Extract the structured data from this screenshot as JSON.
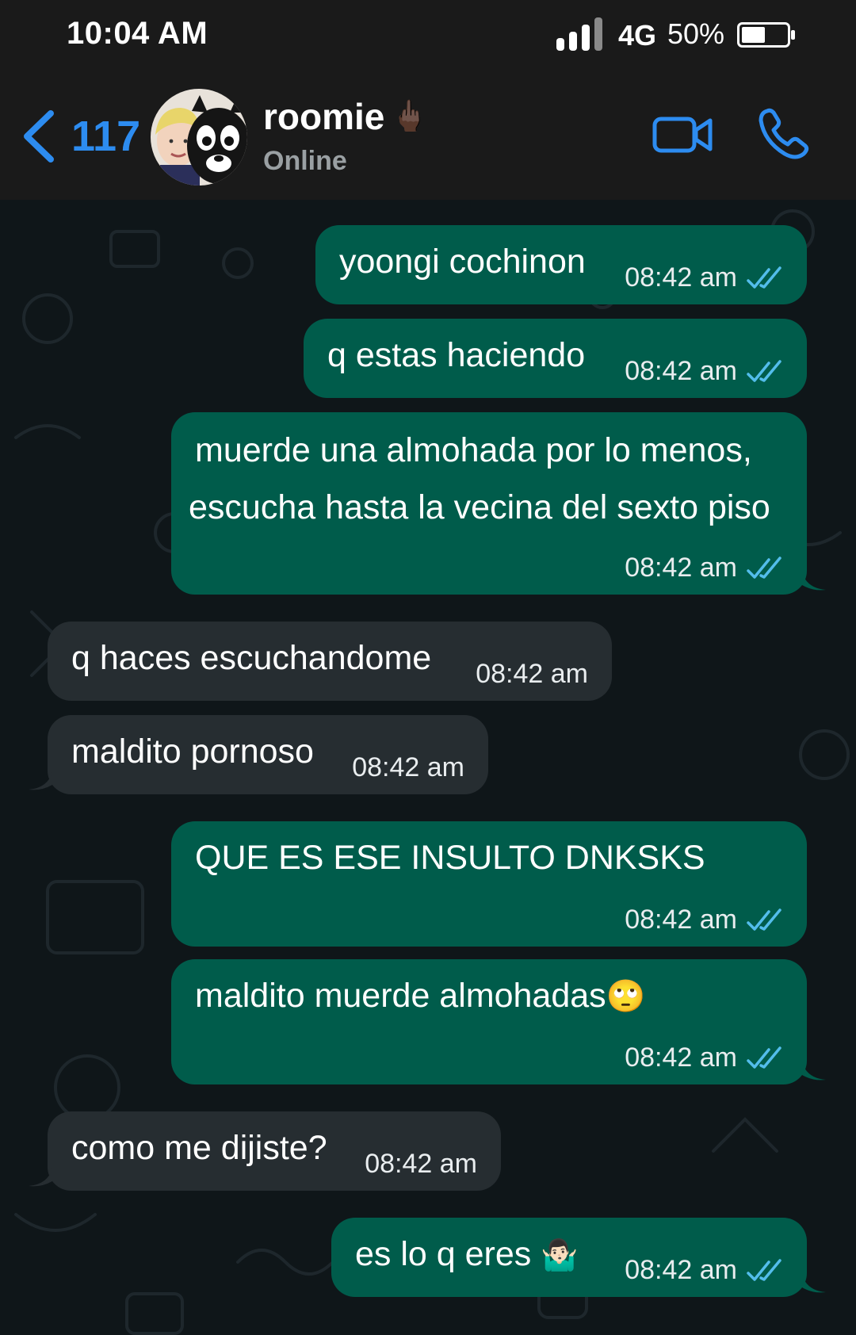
{
  "status_bar": {
    "time": "10:04 AM",
    "network": "4G",
    "battery": "50%",
    "icons": [
      "signal-bars-icon",
      "battery-icon"
    ]
  },
  "header": {
    "back_count": "117",
    "contact_name": "roomie",
    "name_emoji": "🖕🏿",
    "status": "Online",
    "icons": [
      "back-chevron-icon",
      "video-call-icon",
      "phone-icon"
    ],
    "accent_color": "#2d8cf0"
  },
  "colors": {
    "outgoing_bubble": "#005c4b",
    "incoming_bubble": "#262d31",
    "read_tick": "#53bdeb",
    "background": "#0f1619"
  },
  "messages": [
    {
      "direction": "out",
      "text": "yoongi cochinon",
      "time": "08:42 am",
      "read": true
    },
    {
      "direction": "out",
      "text": "q estas haciendo",
      "time": "08:42 am",
      "read": true
    },
    {
      "direction": "out",
      "line1": "muerde una almohada por lo menos,",
      "line2": "escucha hasta la vecina del sexto piso",
      "time": "08:42 am",
      "read": true
    },
    {
      "direction": "in",
      "text": "q haces escuchandome",
      "time": "08:42 am"
    },
    {
      "direction": "in",
      "text": "maldito pornoso",
      "time": "08:42 am"
    },
    {
      "direction": "out",
      "text": "QUE ES ESE INSULTO DNKSKS",
      "time": "08:42 am",
      "read": true
    },
    {
      "direction": "out",
      "text": "maldito muerde almohadas",
      "emoji": "🙄",
      "time": "08:42 am",
      "read": true
    },
    {
      "direction": "in",
      "text": "como me dijiste?",
      "time": "08:42 am"
    },
    {
      "direction": "out",
      "text": "es lo q eres",
      "emoji": "🤷🏻‍♂️",
      "time": "08:42 am",
      "read": true
    }
  ]
}
